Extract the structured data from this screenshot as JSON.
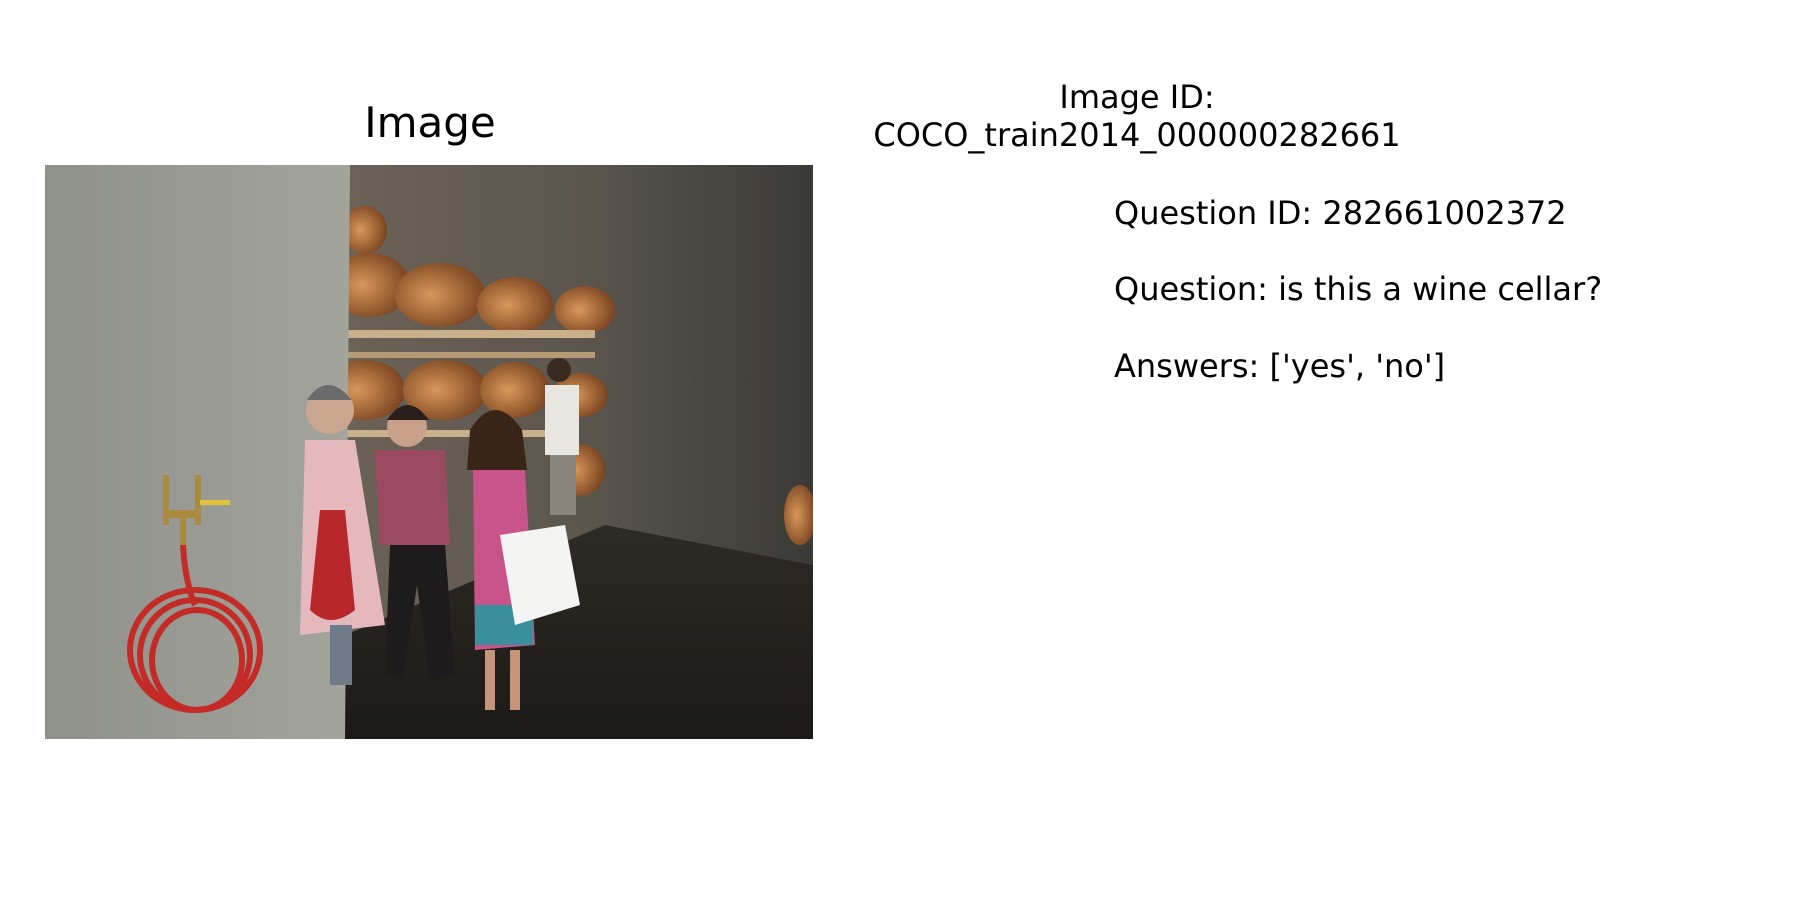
{
  "panel_title": "Image",
  "image_id_label": "Image ID:",
  "image_id_value": "COCO_train2014_000000282661",
  "question_id_line": "Question ID: 282661002372",
  "question_line": "Question: is this a wine cellar?",
  "answers_line": "Answers: ['yes', 'no']",
  "colors": {
    "background": "#ffffff",
    "text": "#000000"
  }
}
